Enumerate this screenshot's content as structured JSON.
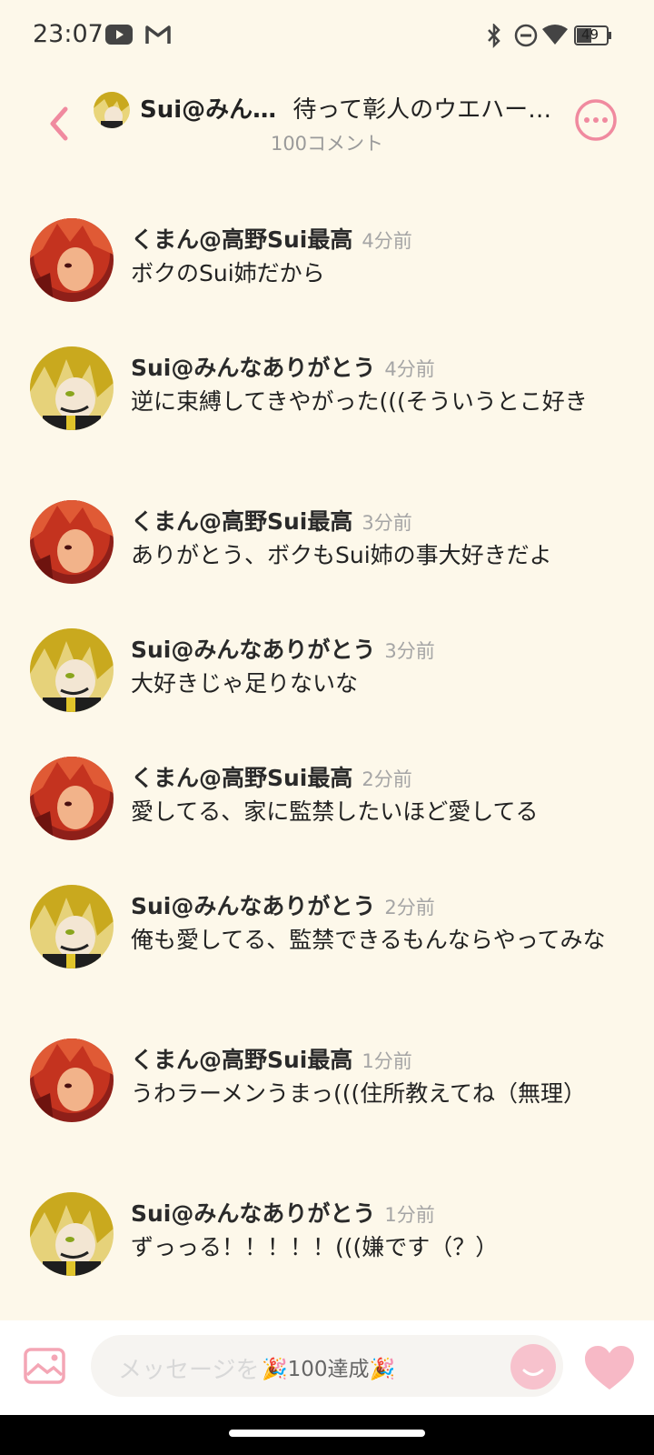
{
  "status": {
    "time": "23:07",
    "battery": "49"
  },
  "header": {
    "author": "Sui@みん…",
    "title": "待って彰人のウエハー…",
    "subtitle": "100コメント"
  },
  "comments": [
    {
      "avatar": "red-hair-avatar",
      "name": "くまん@高野Sui最高",
      "time": "4分前",
      "text": "ボクのSui姉だから"
    },
    {
      "avatar": "yellow-hair-avatar",
      "name": "Sui@みんなありがとう",
      "time": "4分前",
      "text": "逆に束縛してきやがった(((そういうとこ好き"
    },
    {
      "avatar": "red-hair-avatar",
      "name": "くまん@高野Sui最高",
      "time": "3分前",
      "text": "ありがとう、ボクもSui姉の事大好きだよ"
    },
    {
      "avatar": "yellow-hair-avatar",
      "name": "Sui@みんなありがとう",
      "time": "3分前",
      "text": "大好きじゃ足りないな"
    },
    {
      "avatar": "red-hair-avatar",
      "name": "くまん@高野Sui最高",
      "time": "2分前",
      "text": "愛してる、家に監禁したいほど愛してる"
    },
    {
      "avatar": "yellow-hair-avatar",
      "name": "Sui@みんなありがとう",
      "time": "2分前",
      "text": "俺も愛してる、監禁できるもんならやってみな"
    },
    {
      "avatar": "red-hair-avatar",
      "name": "くまん@高野Sui最高",
      "time": "1分前",
      "text": "うわラーメンうまっ(((住所教えてね（無理）"
    },
    {
      "avatar": "yellow-hair-avatar",
      "name": "Sui@みんなありがとう",
      "time": "1分前",
      "text": "ずっっる！！！！！(((嫌です（？）"
    }
  ],
  "input": {
    "placeholder": "メッセージを",
    "badge": "🎉100達成🎉"
  },
  "colors": {
    "background": "#fdf8ea",
    "accent": "#f08a9f",
    "muted": "#a5a5a5"
  },
  "icons": [
    "youtube-icon",
    "gmail-icon",
    "bluetooth-icon",
    "dnd-icon",
    "wifi-icon",
    "battery-icon",
    "back-icon",
    "more-icon",
    "image-icon",
    "emoji-icon",
    "heart-icon"
  ]
}
